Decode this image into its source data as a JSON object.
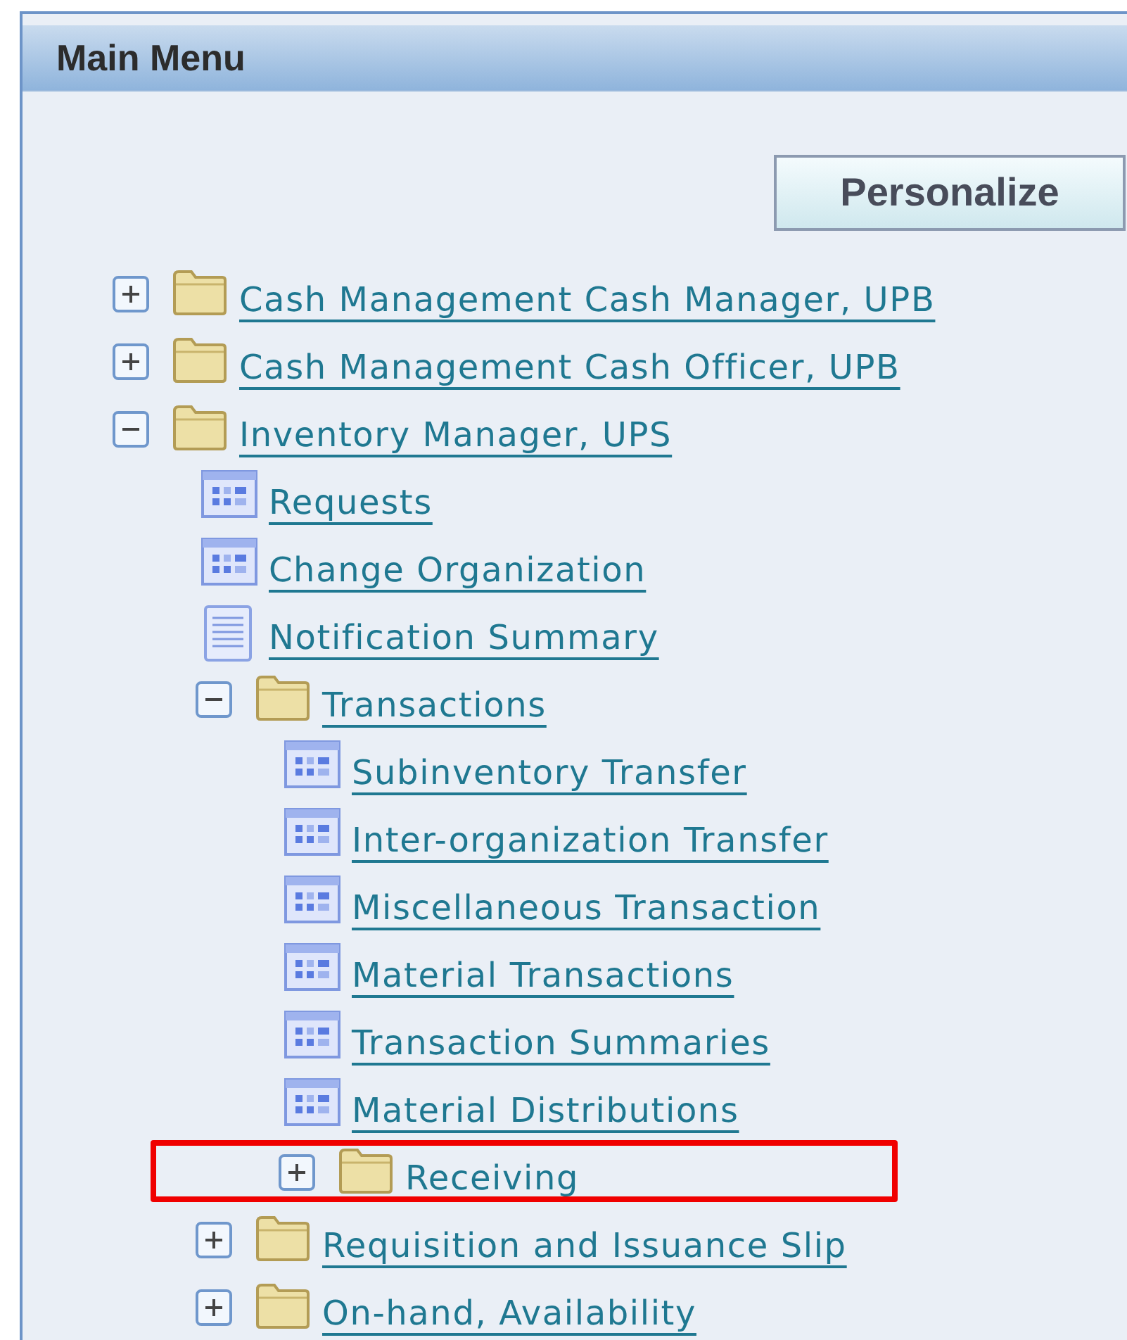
{
  "panel": {
    "title": "Main Menu"
  },
  "personalize_button": {
    "label": "Personalize"
  },
  "menu": [
    {
      "kind": "folder",
      "label": "Cash Management Cash Manager, UPB",
      "expanded": false,
      "highlighted": false
    },
    {
      "kind": "folder",
      "label": "Cash Management Cash Officer, UPB",
      "expanded": false,
      "highlighted": false
    },
    {
      "kind": "folder",
      "label": "Inventory Manager, UPS",
      "expanded": true,
      "highlighted": false,
      "children": [
        {
          "kind": "form",
          "label": "Requests",
          "highlighted": false
        },
        {
          "kind": "form",
          "label": "Change Organization",
          "highlighted": false
        },
        {
          "kind": "document",
          "label": "Notification Summary",
          "highlighted": false
        },
        {
          "kind": "folder",
          "label": "Transactions",
          "expanded": true,
          "highlighted": false,
          "children": [
            {
              "kind": "form",
              "label": "Subinventory Transfer",
              "highlighted": false
            },
            {
              "kind": "form",
              "label": "Inter-organization Transfer",
              "highlighted": false
            },
            {
              "kind": "form",
              "label": "Miscellaneous Transaction",
              "highlighted": false
            },
            {
              "kind": "form",
              "label": "Material Transactions",
              "highlighted": false
            },
            {
              "kind": "form",
              "label": "Transaction Summaries",
              "highlighted": false
            },
            {
              "kind": "form",
              "label": "Material Distributions",
              "highlighted": false
            },
            {
              "kind": "folder",
              "label": "Receiving",
              "expanded": false,
              "highlighted": true
            }
          ]
        },
        {
          "kind": "folder",
          "label": "Requisition and Issuance Slip",
          "expanded": false,
          "highlighted": false
        },
        {
          "kind": "folder",
          "label": "On-hand, Availability",
          "expanded": false,
          "highlighted": false
        }
      ]
    }
  ]
}
